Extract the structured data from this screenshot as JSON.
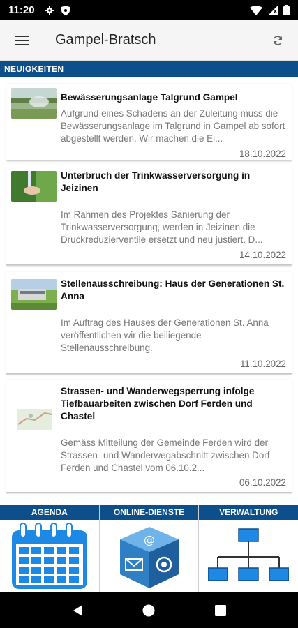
{
  "status_bar": {
    "time": "11:20"
  },
  "app_bar": {
    "title": "Gampel-Bratsch"
  },
  "section": {
    "title": "NEUIGKEITEN"
  },
  "news": [
    {
      "title": "Bewässerungsanlage Talgrund Gampel",
      "excerpt": "Aufgrund eines Schadens an der Zuleitung muss die  Bewässerungsanlage im Talgrund in Gampel ab sofort abgestellt werden.  Wir machen die Ei...",
      "date": "18.10.2022"
    },
    {
      "title": "Unterbruch der Trinkwasserversorgung in Jeizinen",
      "excerpt": "Im Rahmen des Projektes Sanierung der Trinkwasserversorgung, werden in Jeizinen die Druckreduzierventile ersetzt und neu justiert. D...",
      "date": "14.10.2022"
    },
    {
      "title": "Stellenausschreibung: Haus der Generationen St. Anna",
      "excerpt": "Im Auftrag des Hauses der Generationen St. Anna veröffentlichen wir die beiliegende Stellenausschreibung.",
      "date": "11.10.2022"
    },
    {
      "title": "Strassen- und Wanderwegsperrung infolge Tiefbauarbeiten zwischen Dorf Ferden und Chastel",
      "excerpt": "Gemäss Mitteilung der Gemeinde Ferden wird der Strassen- und Wanderwegabschnitt zwischen Dorf Ferden und Chastel vom 06.10.2...",
      "date": "06.10.2022"
    }
  ],
  "tabs": [
    {
      "label": "AGENDA",
      "icon": "calendar-icon"
    },
    {
      "label": "ONLINE-DIENSTE",
      "icon": "online-services-icon"
    },
    {
      "label": "VERWALTUNG",
      "icon": "org-chart-icon"
    }
  ],
  "colors": {
    "accent": "#0d4f8b",
    "calendar": "#1e88e5"
  }
}
